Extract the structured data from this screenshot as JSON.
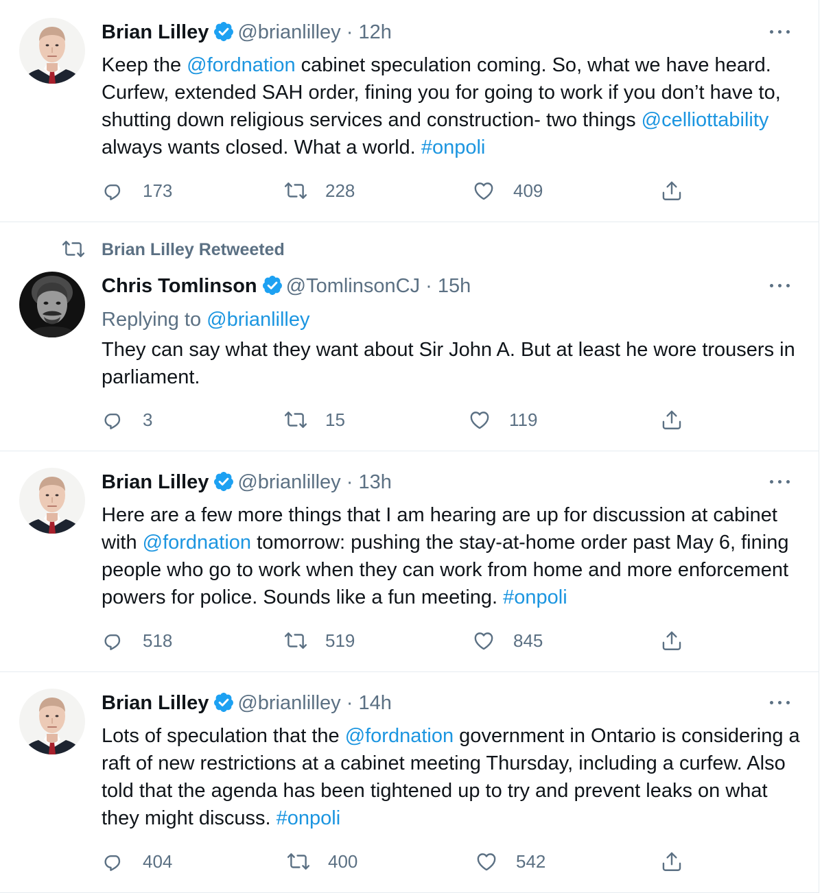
{
  "colors": {
    "link": "#1b95e0",
    "muted": "#5b7083",
    "text": "#0f1419",
    "verified": "#1da1f2"
  },
  "tweets": [
    {
      "author": {
        "name": "Brian Lilley",
        "handle": "@brianlilley",
        "time": "12h",
        "avatar": "avatar-brian"
      },
      "retweet_label": "",
      "reply_prefix": "",
      "reply_handle": "",
      "body": [
        {
          "text": "Keep the ",
          "link": false
        },
        {
          "text": "@fordnation",
          "link": true
        },
        {
          "text": " cabinet speculation coming. So, what we have heard. Curfew, extended SAH order, fining you for going to work if you don’t have to, shutting down religious services and construction- two things ",
          "link": false
        },
        {
          "text": "@celliottability",
          "link": true
        },
        {
          "text": " always wants closed. What a world. ",
          "link": false
        },
        {
          "text": "#onpoli",
          "link": true
        }
      ],
      "replies": "173",
      "retweets": "228",
      "likes": "409"
    },
    {
      "author": {
        "name": "Chris Tomlinson",
        "handle": "@TomlinsonCJ",
        "time": "15h",
        "avatar": "avatar-chris"
      },
      "retweet_label": "Brian Lilley Retweeted",
      "reply_prefix": "Replying to ",
      "reply_handle": "@brianlilley",
      "body": [
        {
          "text": "They can say what they want about Sir John A. But at least he wore trousers in parliament.",
          "link": false
        }
      ],
      "replies": "3",
      "retweets": "15",
      "likes": "119"
    },
    {
      "author": {
        "name": "Brian Lilley",
        "handle": "@brianlilley",
        "time": "13h",
        "avatar": "avatar-brian"
      },
      "retweet_label": "",
      "reply_prefix": "",
      "reply_handle": "",
      "body": [
        {
          "text": "Here are a few more things that I am hearing are up for discussion at cabinet with ",
          "link": false
        },
        {
          "text": "@fordnation",
          "link": true
        },
        {
          "text": " tomorrow: pushing the stay-at-home order past May 6, fining people who go to work when they can work from home and more enforcement powers for police. Sounds like a fun meeting. ",
          "link": false
        },
        {
          "text": "#onpoli",
          "link": true
        }
      ],
      "replies": "518",
      "retweets": "519",
      "likes": "845"
    },
    {
      "author": {
        "name": "Brian Lilley",
        "handle": "@brianlilley",
        "time": "14h",
        "avatar": "avatar-brian"
      },
      "retweet_label": "",
      "reply_prefix": "",
      "reply_handle": "",
      "body": [
        {
          "text": "Lots of speculation that the ",
          "link": false
        },
        {
          "text": "@fordnation",
          "link": true
        },
        {
          "text": " government in Ontario is considering a raft of new restrictions at a cabinet meeting Thursday, including a curfew. Also told that the agenda has been tightened up to try and prevent leaks on what they might discuss. ",
          "link": false
        },
        {
          "text": "#onpoli",
          "link": true
        }
      ],
      "replies": "404",
      "retweets": "400",
      "likes": "542"
    }
  ],
  "icons": {
    "reply": "reply-icon",
    "retweet": "retweet-icon",
    "like": "like-icon",
    "share": "share-icon",
    "verified": "verified-badge-icon",
    "more": "more-options-icon"
  }
}
